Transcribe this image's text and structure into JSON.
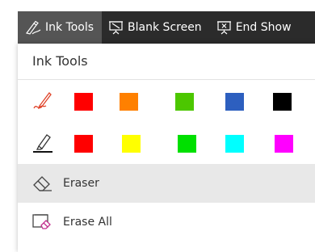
{
  "toolbar": {
    "ink_tools": "Ink Tools",
    "blank_screen": "Blank Screen",
    "end_show": "End Show"
  },
  "panel": {
    "title": "Ink Tools",
    "pen_colors": [
      "#ff0000",
      "#ff8000",
      "#4cc700",
      "#2d5fbf",
      "#000000"
    ],
    "highlighter_colors": [
      "#ff0000",
      "#ffff00",
      "#00e000",
      "#00ffff",
      "#ff00ff"
    ],
    "eraser_label": "Eraser",
    "erase_all_label": "Erase All"
  },
  "icons": {
    "ink_tools": "pen-hand-icon",
    "blank_screen": "presentation-screen-icon",
    "end_show": "end-show-icon",
    "pen": "pen-icon",
    "highlighter": "highlighter-icon",
    "eraser": "eraser-icon",
    "erase_all": "erase-all-icon"
  }
}
